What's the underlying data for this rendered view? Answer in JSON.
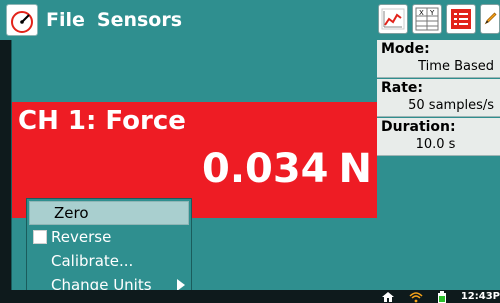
{
  "app": {
    "menu": [
      "File",
      "Sensors"
    ]
  },
  "toolbar": {
    "icons": [
      "graph-icon",
      "table-icon",
      "list-icon",
      "pencil-icon"
    ],
    "table_icon_letters": [
      "X",
      "Y"
    ]
  },
  "sensor": {
    "channel_label": "CH 1: Force",
    "value": "0.034",
    "unit": "N"
  },
  "info": {
    "mode_label": "Mode:",
    "mode_value": "Time Based",
    "rate_label": "Rate:",
    "rate_value": "50 samples/s",
    "duration_label": "Duration:",
    "duration_value": "10.0 s"
  },
  "context_menu": {
    "items": [
      {
        "label": "Zero",
        "selected": true
      },
      {
        "label": "Reverse",
        "checkbox": true,
        "checked": false
      },
      {
        "label": "Calibrate...",
        "selected": false
      },
      {
        "label": "Change Units",
        "submenu": true
      }
    ]
  },
  "status": {
    "time": "12:43P"
  },
  "colors": {
    "teal": "#2f8f8f",
    "red": "#ee1c24",
    "dark": "#0e1a1c",
    "panel": "#e8ecea"
  }
}
